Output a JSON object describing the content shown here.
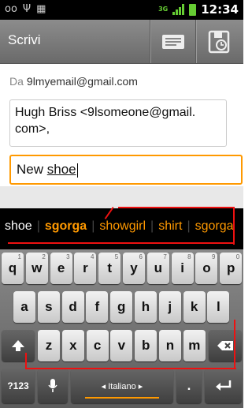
{
  "status": {
    "time": "12:34",
    "network": "3G"
  },
  "header": {
    "title": "Scrivi"
  },
  "compose": {
    "from_label": "Da",
    "from_value": "9lmyemail@gmail.com",
    "to_value": "Hugh Briss <9lsomeone@gmail. com>,",
    "subject_prefix": "New ",
    "subject_word": "shoe"
  },
  "suggestions": [
    "shoe",
    "sgorga",
    "showgirl",
    "shirt",
    "sgorga"
  ],
  "keyboard": {
    "row1": [
      {
        "k": "q",
        "n": "1"
      },
      {
        "k": "w",
        "n": "2"
      },
      {
        "k": "e",
        "n": "3"
      },
      {
        "k": "r",
        "n": "4"
      },
      {
        "k": "t",
        "n": "5"
      },
      {
        "k": "y",
        "n": "6"
      },
      {
        "k": "u",
        "n": "7"
      },
      {
        "k": "i",
        "n": "8"
      },
      {
        "k": "o",
        "n": "9"
      },
      {
        "k": "p",
        "n": "0"
      }
    ],
    "row2": [
      "a",
      "s",
      "d",
      "f",
      "g",
      "h",
      "j",
      "k",
      "l"
    ],
    "row3": [
      "z",
      "x",
      "c",
      "v",
      "b",
      "n",
      "m"
    ],
    "symbols_label": "?123",
    "space_label": "◂ Italiano ▸",
    "period": "."
  }
}
